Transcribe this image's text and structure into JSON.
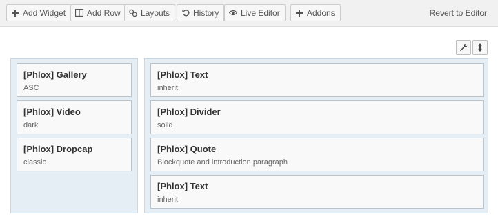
{
  "toolbar": {
    "add_widget": "Add Widget",
    "add_row": "Add Row",
    "layouts": "Layouts",
    "history": "History",
    "live_editor": "Live Editor",
    "addons": "Addons",
    "revert": "Revert to Editor"
  },
  "row_actions": {
    "edit_icon": "wrench-icon",
    "move_icon": "vertical-arrows-icon"
  },
  "cells": [
    {
      "widgets": [
        {
          "title": "[Phlox] Gallery",
          "desc": "ASC"
        },
        {
          "title": "[Phlox] Video",
          "desc": "dark"
        },
        {
          "title": "[Phlox] Dropcap",
          "desc": "classic"
        }
      ]
    },
    {
      "widgets": [
        {
          "title": "[Phlox] Text",
          "desc": "inherit"
        },
        {
          "title": "[Phlox] Divider",
          "desc": "solid"
        },
        {
          "title": "[Phlox] Quote",
          "desc": "Blockquote and introduction paragraph"
        },
        {
          "title": "[Phlox] Text",
          "desc": "inherit"
        }
      ]
    }
  ],
  "colors": {
    "cell_bg": "#e4eef4",
    "cell_border": "#c5d8e3",
    "widget_bg": "#f9f9f9"
  }
}
